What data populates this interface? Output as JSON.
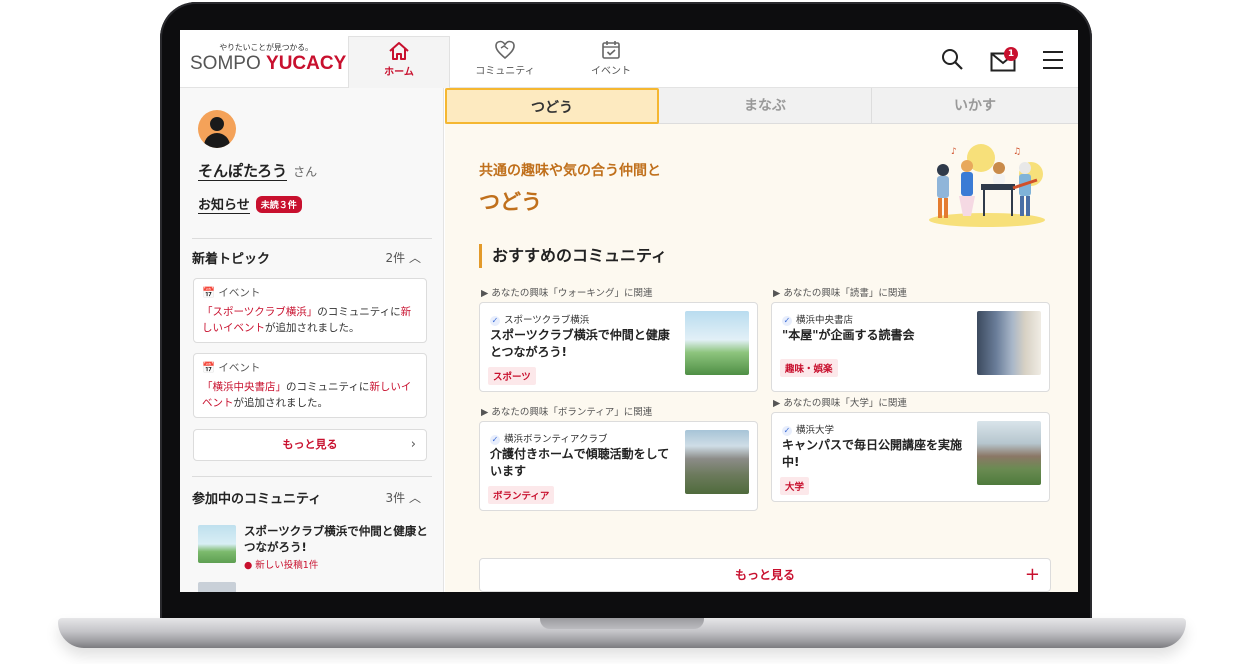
{
  "header": {
    "logo_tagline": "やりたいことが見つかる。",
    "logo_brand": "SOMPO",
    "logo_product": "YUCACY",
    "tabs": [
      {
        "label": "ホーム"
      },
      {
        "label": "コミュニティ"
      },
      {
        "label": "イベント"
      }
    ],
    "mail_badge": "1",
    "accent_color": "#c8102e"
  },
  "sidebar": {
    "user_name": "そんぽたろう",
    "user_suffix": "さん",
    "news_label": "お知らせ",
    "unread_badge": "未読３件",
    "topics": {
      "title": "新着トピック",
      "count": "2件",
      "items": [
        {
          "type": "イベント",
          "pre": "「スポーツクラブ横浜」",
          "mid": "のコミュニティに",
          "highlight": "新しいイベント",
          "post": "が追加されました。"
        },
        {
          "type": "イベント",
          "pre": "「横浜中央書店」",
          "mid": "のコミュニティに",
          "highlight": "新しいイベント",
          "post": "が追加されました。"
        }
      ],
      "more_label": "もっと見る"
    },
    "joined": {
      "title": "参加中のコミュニティ",
      "count": "3件",
      "items": [
        {
          "title": "スポーツクラブ横浜で仲間と健康とつながろう!",
          "note": "● 新しい投稿1件"
        }
      ]
    }
  },
  "main": {
    "subtabs": [
      {
        "label": "つどう",
        "active": true
      },
      {
        "label": "まなぶ",
        "active": false
      },
      {
        "label": "いかす",
        "active": false
      }
    ],
    "hero_subtitle": "共通の趣味や気の合う仲間と",
    "hero_title": "つどう",
    "section_title": "おすすめのコミュニティ",
    "cards": [
      {
        "related": "▶ あなたの興味「ウォーキング」に関連",
        "org": "スポーツクラブ横浜",
        "title": "スポーツクラブ横浜で仲間と健康とつながろう!",
        "tag": "スポーツ"
      },
      {
        "related": "▶ あなたの興味「読書」に関連",
        "org": "横浜中央書店",
        "title": "\"本屋\"が企画する読書会",
        "tag": "趣味・娯楽"
      },
      {
        "related": "▶ あなたの興味「ボランティア」に関連",
        "org": "横浜ボランティアクラブ",
        "title": "介護付きホームで傾聴活動をしています",
        "tag": "ボランティア"
      },
      {
        "related": "▶ あなたの興味「大学」に関連",
        "org": "横浜大学",
        "title": "キャンパスで毎日公開講座を実施中!",
        "tag": "大学"
      }
    ],
    "more_label": "もっと見る"
  }
}
